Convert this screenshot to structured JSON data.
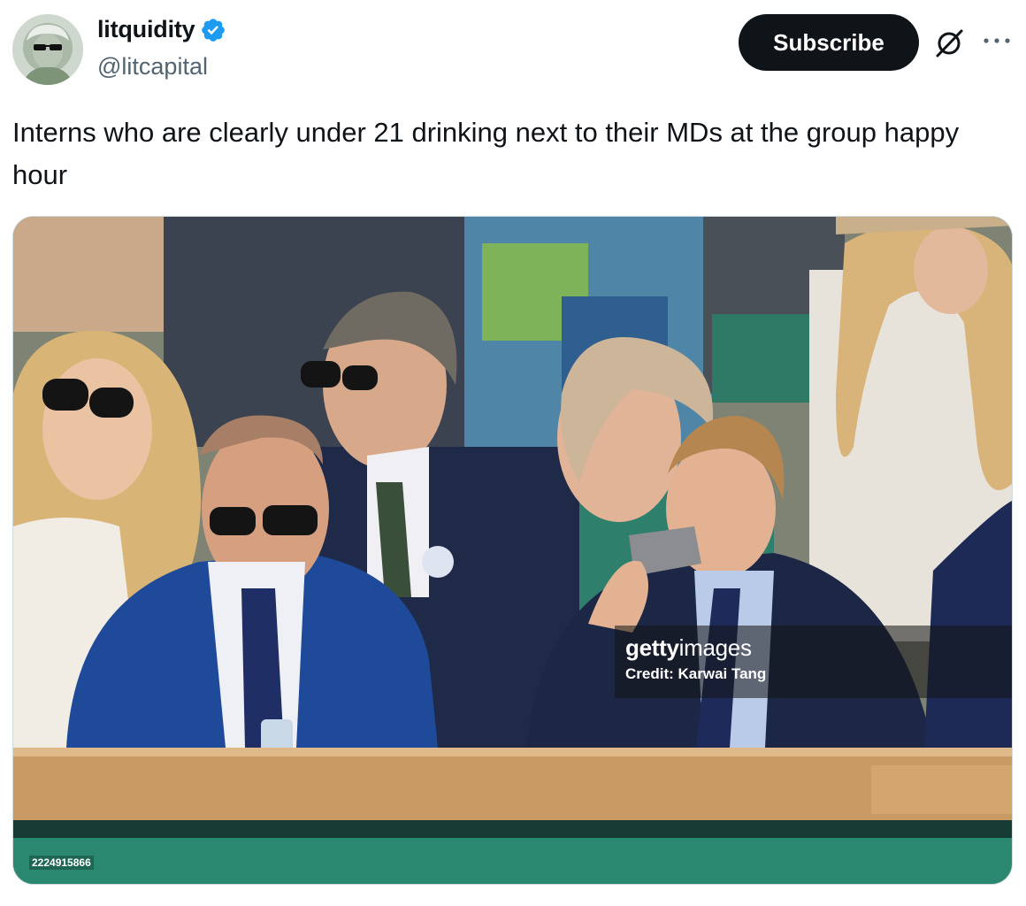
{
  "tweet": {
    "author_name": "litquidity",
    "author_handle": "@litcapital",
    "verified": true,
    "subscribe_label": "Subscribe",
    "text": "Interns who are clearly under 21 drinking next to their MDs at the group happy hour"
  },
  "media": {
    "watermark_brand_bold": "getty",
    "watermark_brand_light": "images",
    "watermark_credit": "Credit: Karwai Tang",
    "image_id": "2224915866"
  },
  "icons": {
    "verified": "verified-badge-icon",
    "grok": "grok-icon",
    "more": "more-options-icon"
  },
  "colors": {
    "verified_blue": "#1d9bf0",
    "subscribe_bg": "#0f1419",
    "text": "#0f1419",
    "secondary_text": "#536471"
  }
}
